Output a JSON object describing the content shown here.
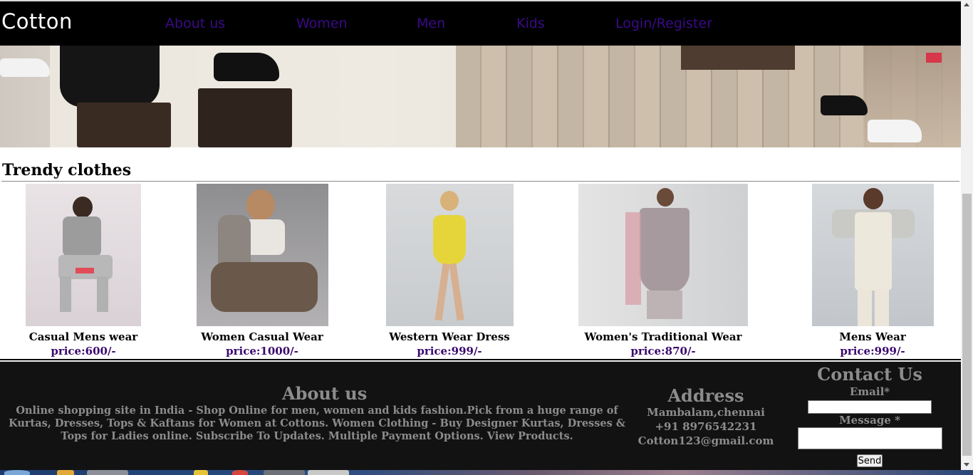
{
  "header": {
    "brand": "Cotton",
    "nav": [
      "About us",
      "Women",
      "Men",
      "Kids",
      "Login/Register"
    ]
  },
  "section": {
    "title": "Trendy clothes"
  },
  "products": [
    {
      "name": "Casual Mens wear",
      "price": "price:600/-"
    },
    {
      "name": "Women Casual Wear",
      "price": "price:1000/-"
    },
    {
      "name": "Western Wear Dress",
      "price": "price:999/-"
    },
    {
      "name": "Women's Traditional Wear",
      "price": "price:870/-"
    },
    {
      "name": "Mens Wear",
      "price": "price:999/-"
    }
  ],
  "footer": {
    "about": {
      "title": "About us",
      "text": "Online shopping site in India - Shop Online for men, women and kids fashion.Pick from a huge range of Kurtas, Dresses, Tops & Kaftans for Women at Cottons. Women Clothing - Buy Designer Kurtas, Dresses & Tops for Ladies online. Subscribe To Updates. Multiple Payment Options. View Products."
    },
    "address": {
      "title": "Address",
      "lines": [
        "Mambalam,chennai",
        "+91 8976542231",
        "Cotton123@gmail.com"
      ]
    },
    "contact": {
      "title": "Contact Us",
      "email_label": "Email*",
      "message_label": "Message *",
      "send_label": "Send"
    }
  },
  "colors": {
    "nav_link": "#3b0a87",
    "price": "#3b0a6e",
    "footer_bg": "#121212",
    "footer_text": "#8c8c8c"
  }
}
